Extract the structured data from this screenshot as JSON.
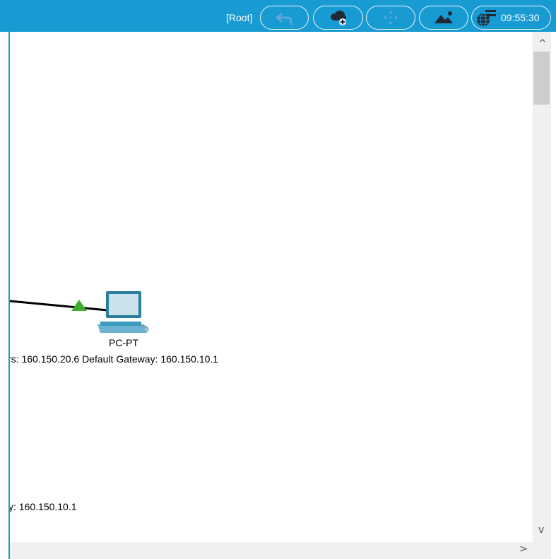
{
  "toolbar": {
    "root_label": "[Root]",
    "buttons": [
      {
        "icon": "back-arrow-icon"
      },
      {
        "icon": "cloud-add-icon"
      },
      {
        "icon": "move-icon"
      },
      {
        "icon": "image-background-icon"
      },
      {
        "icon": "clock-viewport-icon"
      }
    ],
    "clock": "09:55:30"
  },
  "workspace": {
    "device_label": "PC-PT",
    "device_info_line": "rs: 160.150.20.6 Default Gateway: 160.150.10.1",
    "other_info_line": "y: 160.150.10.1",
    "link_status": "up"
  },
  "scrollbars": {
    "up": "^",
    "down": "v",
    "right": ">"
  },
  "colors": {
    "toolbar_bg": "#189ad3",
    "link_up": "#3dae2b",
    "workspace_bg": "#ffffff"
  }
}
